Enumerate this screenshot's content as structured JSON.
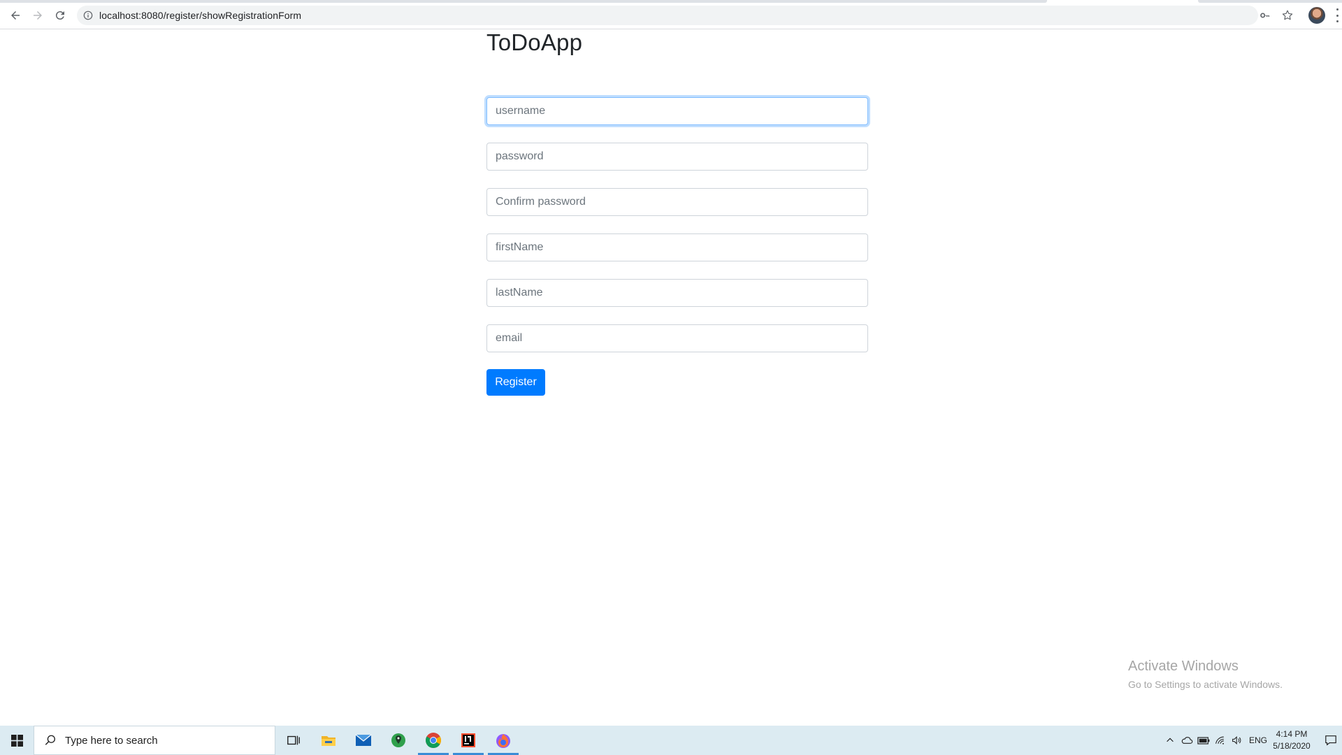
{
  "browser": {
    "url": "localhost:8080/register/showRegistrationForm",
    "icons": [
      "back-arrow-icon",
      "forward-arrow-icon",
      "reload-icon",
      "site-info-icon",
      "key-icon",
      "star-icon",
      "profile-avatar",
      "menu-kebab-icon"
    ]
  },
  "page": {
    "title": "ToDoApp",
    "form": {
      "username_placeholder": "username",
      "password_placeholder": "password",
      "confirm_password_placeholder": "Confirm password",
      "first_name_placeholder": "firstName",
      "last_name_placeholder": "lastName",
      "email_placeholder": "email",
      "submit_label": "Register"
    },
    "accent_color": "#007bff"
  },
  "watermark": {
    "line1": "Activate Windows",
    "line2": "Go to Settings to activate Windows."
  },
  "taskbar": {
    "search_placeholder": "Type here to search",
    "apps": [
      "task-view-icon",
      "file-explorer-icon",
      "mail-icon",
      "maps-icon",
      "chrome-icon",
      "intellij-icon",
      "firefox-dev-icon"
    ],
    "language": "ENG",
    "time": "4:14 PM",
    "date": "5/18/2020"
  }
}
